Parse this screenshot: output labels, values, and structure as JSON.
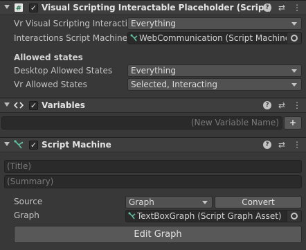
{
  "component1": {
    "title": "Visual Scripting Interactable Placeholder (Script)",
    "checked": "✓",
    "icon": "hash-script-icon",
    "fields": [
      {
        "label": "Vr Visual Scripting Interactio",
        "value": "Everything"
      },
      {
        "label": "Interactions Script Machine",
        "value": "WebCommunication (Script Machine)"
      }
    ],
    "allowed_states_header": "Allowed states",
    "allowed_fields": [
      {
        "label": "Desktop Allowed States",
        "value": "Everything"
      },
      {
        "label": "Vr Allowed States",
        "value": "Selected, Interacting"
      }
    ]
  },
  "component2": {
    "title": "Variables",
    "checked": "✓",
    "icon": "code-brackets-icon",
    "new_var_placeholder": "(New Variable Name)",
    "add_label": "+"
  },
  "component3": {
    "title": "Script Machine",
    "checked": "✓",
    "icon": "script-machine-icon",
    "title_placeholder": "(Title)",
    "summary_placeholder": "(Summary)",
    "source_label": "Source",
    "source_value": "Graph",
    "convert_label": "Convert",
    "graph_label": "Graph",
    "graph_value": "TextBoxGraph (Script Graph Asset)",
    "edit_graph_label": "Edit Graph"
  },
  "header_buttons": {
    "help": "?",
    "presets": "⇄",
    "more": "⋮"
  },
  "colors": {
    "accent_green": "#62c3a3",
    "background": "#383838",
    "header": "#3e3e3e"
  }
}
